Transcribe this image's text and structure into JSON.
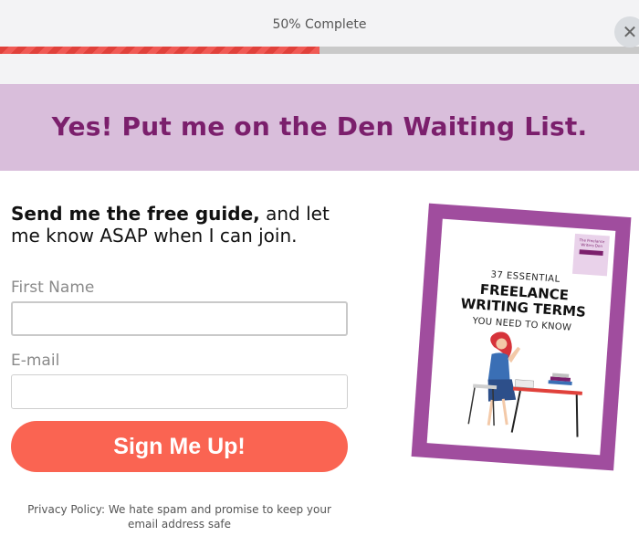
{
  "progress": {
    "label": "50% Complete",
    "value": 0.5
  },
  "close": {
    "icon": "close-icon",
    "glyph": "✕"
  },
  "banner": {
    "title": "Yes! Put me on the Den Waiting List."
  },
  "intro": {
    "bold": "Send me the free guide,",
    "rest": " and let me know ASAP when I can join."
  },
  "form": {
    "first_name": {
      "label": "First Name",
      "value": "",
      "placeholder": ""
    },
    "email": {
      "label": "E-mail",
      "value": "",
      "placeholder": ""
    },
    "submit_label": "Sign Me Up!"
  },
  "privacy": "Privacy Policy: We hate spam and promise to keep your email address safe",
  "book": {
    "ribbon": "The Freelance Writers Den",
    "line1": "37 ESSENTIAL",
    "line2": "FREELANCE",
    "line3": "WRITING TERMS",
    "line4": "YOU NEED TO KNOW"
  },
  "colors": {
    "accent": "#fa6452",
    "brand": "#7b1f6c",
    "banner_bg": "#d9bedb",
    "progress_fill": "#e0413b",
    "book_frame": "#a04d9e"
  }
}
